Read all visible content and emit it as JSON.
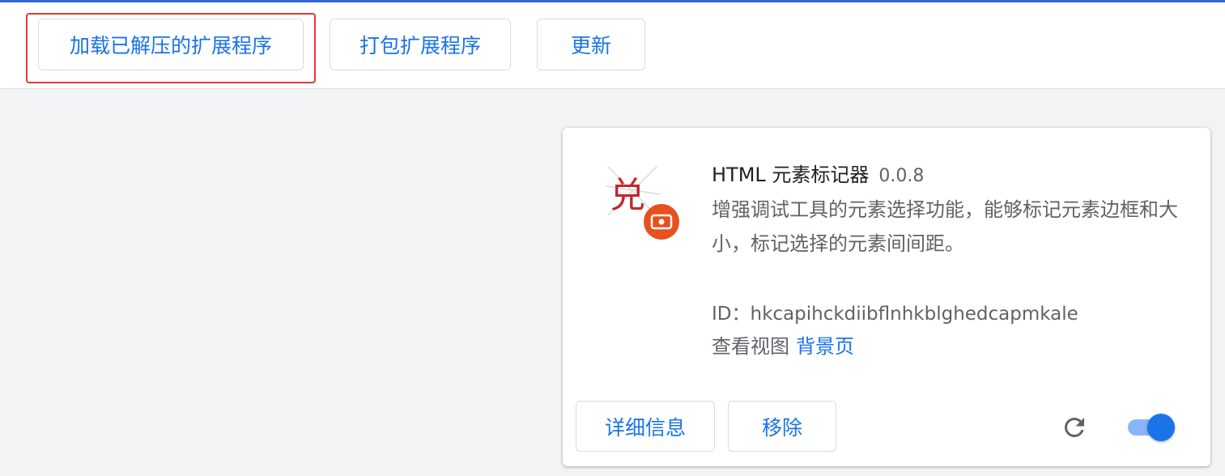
{
  "toolbar": {
    "load_unpacked_label": "加载已解压的扩展程序",
    "pack_extension_label": "打包扩展程序",
    "update_label": "更新"
  },
  "extension": {
    "name": "HTML 元素标记器",
    "version": "0.0.8",
    "description": "增强调试工具的元素选择功能，能够标记元素边框和大小，标记选择的元素间间距。",
    "id_text": "ID：hkcapihckdiibflnhkblghedcapmkale",
    "inspect_views_label": "查看视图",
    "background_page_label": "背景页",
    "details_label": "详细信息",
    "remove_label": "移除",
    "enabled": true,
    "icon_glyph": "兑"
  },
  "colors": {
    "accent": "#1a73e8",
    "highlight_box": "#e03a3a",
    "icon_badge": "#e8501f"
  }
}
